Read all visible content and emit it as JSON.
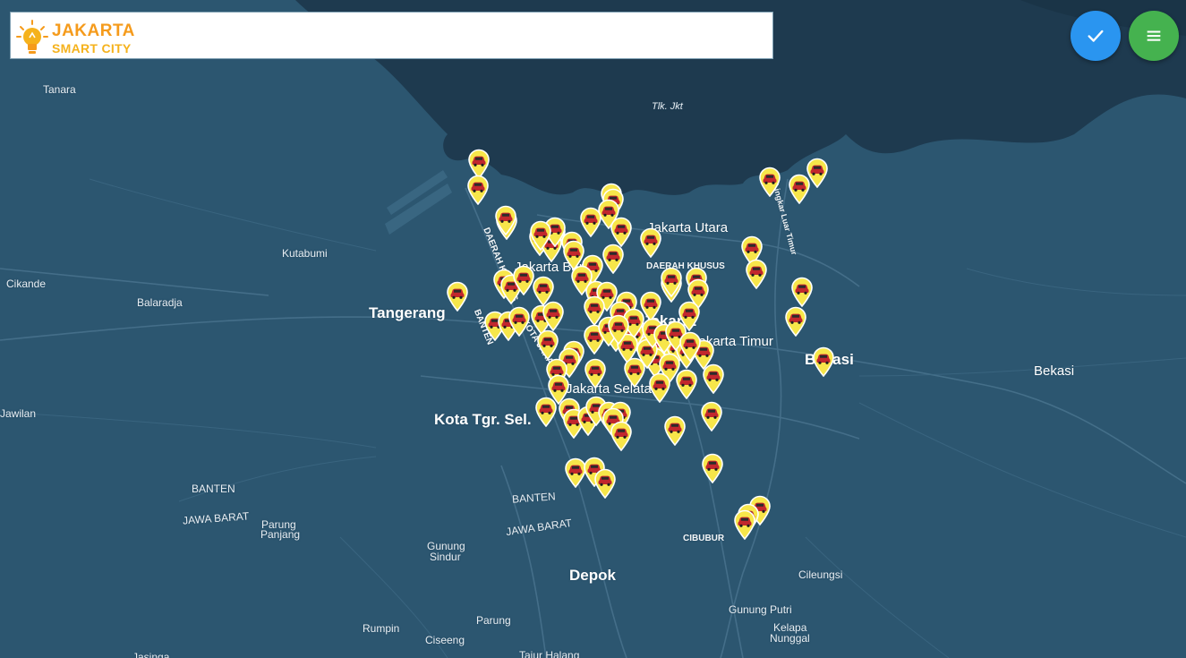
{
  "header": {
    "logo_line1": "JAKARTA",
    "logo_line2": "SMART CITY"
  },
  "actions": {
    "check_icon": "check-icon",
    "menu_icon": "menu-icon"
  },
  "map_labels": {
    "tanara": "Tanara",
    "tlk_jkt": "Tlk. Jkt",
    "jakarta_utara": "Jakarta Utara",
    "daerah_khusus_n": "DAERAH KHUSUS",
    "kutabumi": "Kutabumi",
    "cikande": "Cikande",
    "balaradja": "Balaradja",
    "tangerang": "Tangerang",
    "jakarta_barat": "Jakarta Barat",
    "jakarta": "Jakarta",
    "jakarta_timur": "Jakarta Timur",
    "bekasi_city": "Bekasi",
    "bekasi": "Bekasi",
    "jawilan": "Jawilan",
    "kota_tgr_sel": "Kota Tgr. Sel.",
    "jakarta_selatan": "Jakarta Selatan",
    "banten_w": "BANTEN",
    "jawa_barat_w": "JAWA BARAT",
    "parung_panjang_1": "Parung",
    "parung_panjang_2": "Panjang",
    "banten_s": "BANTEN",
    "jawa_barat_s": "JAWA BARAT",
    "gunung_sindur_1": "Gunung",
    "gunung_sindur_2": "Sindur",
    "depok": "Depok",
    "cibubur": "CIBUBUR",
    "cileungsi": "Cileungsi",
    "gunung_putri": "Gunung Putri",
    "kelapa_nunggal_1": "Kelapa",
    "kelapa_nunggal_2": "Nunggal",
    "rumpin": "Rumpin",
    "parung": "Parung",
    "ciseeng": "Ciseeng",
    "tajur_halang": "Tajur Halang",
    "jasinga": "Jasinga",
    "lingkar_luar": "Lingkar Luar Timur",
    "daerah_khusus_w": "DAERAH KHUSUS",
    "banten_v": "BANTEN",
    "kota_jakarta": "KOTA JAKARTA"
  },
  "colors": {
    "sea": "#1e3a4f",
    "land": "#2c5670",
    "pin_fill": "#f7e64a",
    "pin_border": "#ffffff",
    "logo_orange": "#f59b1c",
    "fab_blue": "#2a95f0",
    "fab_green": "#45b24f"
  },
  "markers": {
    "icon": "vehicle-marker-icon",
    "count": 110
  }
}
